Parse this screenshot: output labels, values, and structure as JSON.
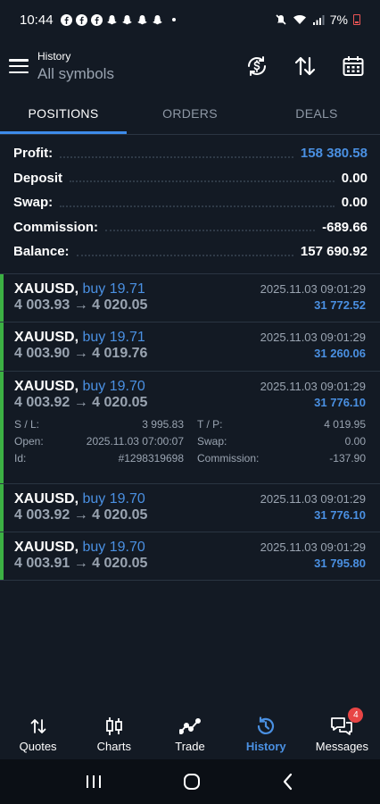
{
  "status_bar": {
    "time": "10:44",
    "battery": "7%",
    "app_icons": [
      "facebook-icon",
      "facebook-icon",
      "facebook-icon",
      "snapchat-icon",
      "snapchat-icon",
      "snapchat-icon",
      "snapchat-icon"
    ]
  },
  "header": {
    "subtitle": "History",
    "title": "All symbols"
  },
  "tabs": [
    {
      "label": "POSITIONS",
      "active": true
    },
    {
      "label": "ORDERS",
      "active": false
    },
    {
      "label": "DEALS",
      "active": false
    }
  ],
  "summary": [
    {
      "label": "Profit:",
      "value": "158 380.58"
    },
    {
      "label": "Deposit",
      "value": "0.00"
    },
    {
      "label": "Swap:",
      "value": "0.00"
    },
    {
      "label": "Commission:",
      "value": "-689.66"
    },
    {
      "label": "Balance:",
      "value": "157 690.92"
    }
  ],
  "positions": [
    {
      "symbol": "XAUUSD,",
      "side": "buy 19.71",
      "time": "2025.11.03 09:01:29",
      "prices": "4 003.93 → 4 020.05",
      "profit": "31 772.52"
    },
    {
      "symbol": "XAUUSD,",
      "side": "buy 19.71",
      "time": "2025.11.03 09:01:29",
      "prices": "4 003.90 → 4 019.76",
      "profit": "31 260.06"
    },
    {
      "symbol": "XAUUSD,",
      "side": "buy 19.70",
      "time": "2025.11.03 09:01:29",
      "prices": "4 003.92 → 4 020.05",
      "profit": "31 776.10",
      "details": {
        "sl_label": "S / L:",
        "sl": "3 995.83",
        "tp_label": "T / P:",
        "tp": "4 019.95",
        "open_label": "Open:",
        "open": "2025.11.03 07:00:07",
        "swap_label": "Swap:",
        "swap": "0.00",
        "id_label": "Id:",
        "id": "#1298319698",
        "comm_label": "Commission:",
        "comm": "-137.90"
      }
    },
    {
      "symbol": "XAUUSD,",
      "side": "buy 19.70",
      "time": "2025.11.03 09:01:29",
      "prices": "4 003.92 → 4 020.05",
      "profit": "31 776.10"
    },
    {
      "symbol": "XAUUSD,",
      "side": "buy 19.70",
      "time": "2025.11.03 09:01:29",
      "prices": "4 003.91 → 4 020.05",
      "profit": "31 795.80"
    }
  ],
  "bottom_nav": [
    {
      "label": "Quotes",
      "icon": "up-down-arrows-icon"
    },
    {
      "label": "Charts",
      "icon": "candlestick-icon"
    },
    {
      "label": "Trade",
      "icon": "trend-line-icon"
    },
    {
      "label": "History",
      "icon": "history-clock-icon",
      "active": true
    },
    {
      "label": "Messages",
      "icon": "chat-bubbles-icon",
      "badge": "4"
    }
  ],
  "colors": {
    "background": "#131a24",
    "accent": "#4a90e2",
    "tab_indicator": "#3d8bea",
    "position_bar": "#3cb043",
    "badge": "#e84545"
  }
}
